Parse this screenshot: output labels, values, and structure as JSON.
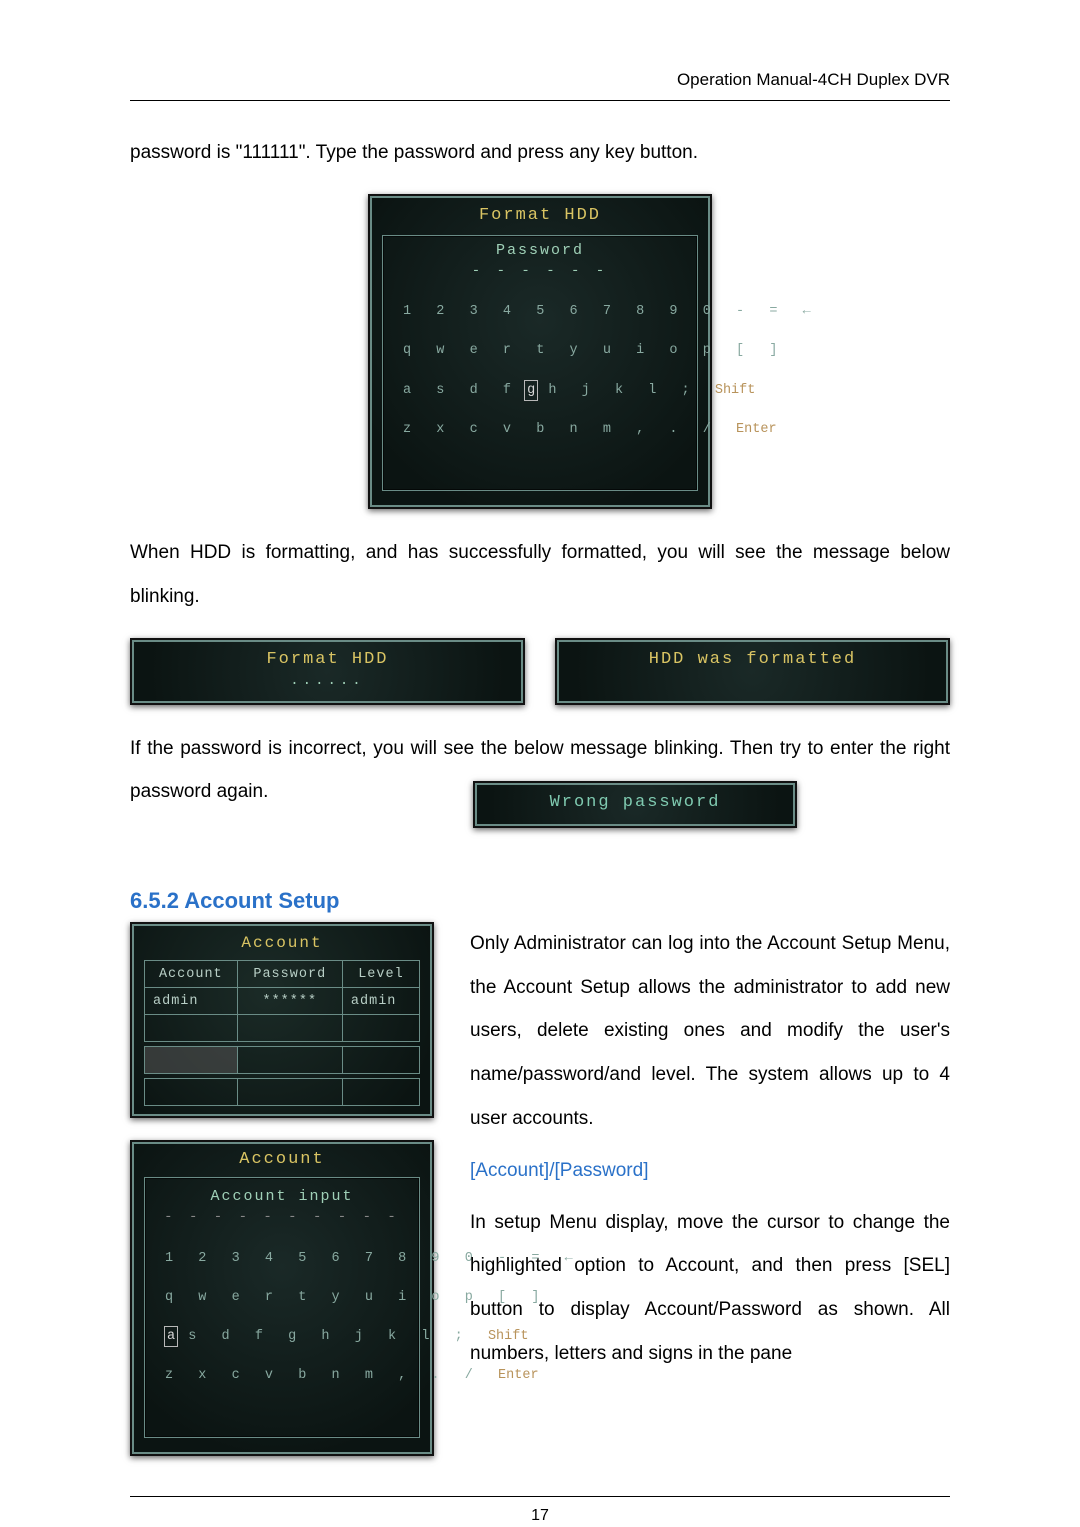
{
  "header": {
    "doc_title": "Operation Manual-4CH Duplex DVR"
  },
  "text": {
    "p1": "password is \"111111\". Type the password and press any key button.",
    "p2": "When HDD is formatting, and has successfully formatted, you will see the message below blinking.",
    "p3": "If the password is incorrect, you will see the below message blinking. Then try to enter the right password again.",
    "sec_heading": "6.5.2 Account Setup",
    "p4": "Only Administrator can log into the Account Setup Menu, the Account Setup allows the administrator to add new users, delete existing ones and modify the user's name/password/and level. The system allows up to 4 user accounts.",
    "blue": "[Account]/[Password]",
    "p5": "In setup Menu display, move the cursor to change the highlighted option to Account, and then press [SEL] button to display Account/Password as shown. All numbers, letters and signs in the pane"
  },
  "osd": {
    "format_hdd": {
      "title": "Format  HDD",
      "subtitle": "Password",
      "dots": "- - - - - -",
      "kbd_rows": [
        "1  2  3  4  5  6  7  8  9  0  -  =  ←",
        "q  w  e  r  t  y  u  i  o  p  [  ]",
        "a  s  d  f |g| h  j  k  l  ;  Shift",
        "z  x  c  v  b  n  m  ,  .  /  Enter"
      ],
      "hl_char": "g"
    },
    "bar_formatting": {
      "title": "Format  HDD",
      "dots": "......"
    },
    "bar_formatted": {
      "title": "HDD  was  formatted"
    },
    "bar_wrong": {
      "title": "Wrong  password"
    },
    "account_table": {
      "title": "Account",
      "headers": [
        "Account",
        "Password",
        "Level"
      ],
      "rows": [
        {
          "account": "admin",
          "password": "******",
          "level": "admin"
        },
        {
          "account": "",
          "password": "",
          "level": ""
        },
        {
          "account": "",
          "password": "",
          "level": "",
          "selected_col": 0
        },
        {
          "account": "",
          "password": "",
          "level": ""
        }
      ]
    },
    "account_input": {
      "title": "Account",
      "subtitle": "Account  input",
      "dashes": "- - - - - - - - - -",
      "kbd_rows": [
        "1  2  3  4  5  6  7  8  9  0  -  =  ←",
        "q  w  e  r  t  y  u  i  o  p  [  ]",
        "|a| s  d  f  g  h  j  k  l  ;  Shift",
        "z  x  c  v  b  n  m  ,  .  /  Enter"
      ],
      "hl_char": "a"
    }
  },
  "page_number": "17"
}
